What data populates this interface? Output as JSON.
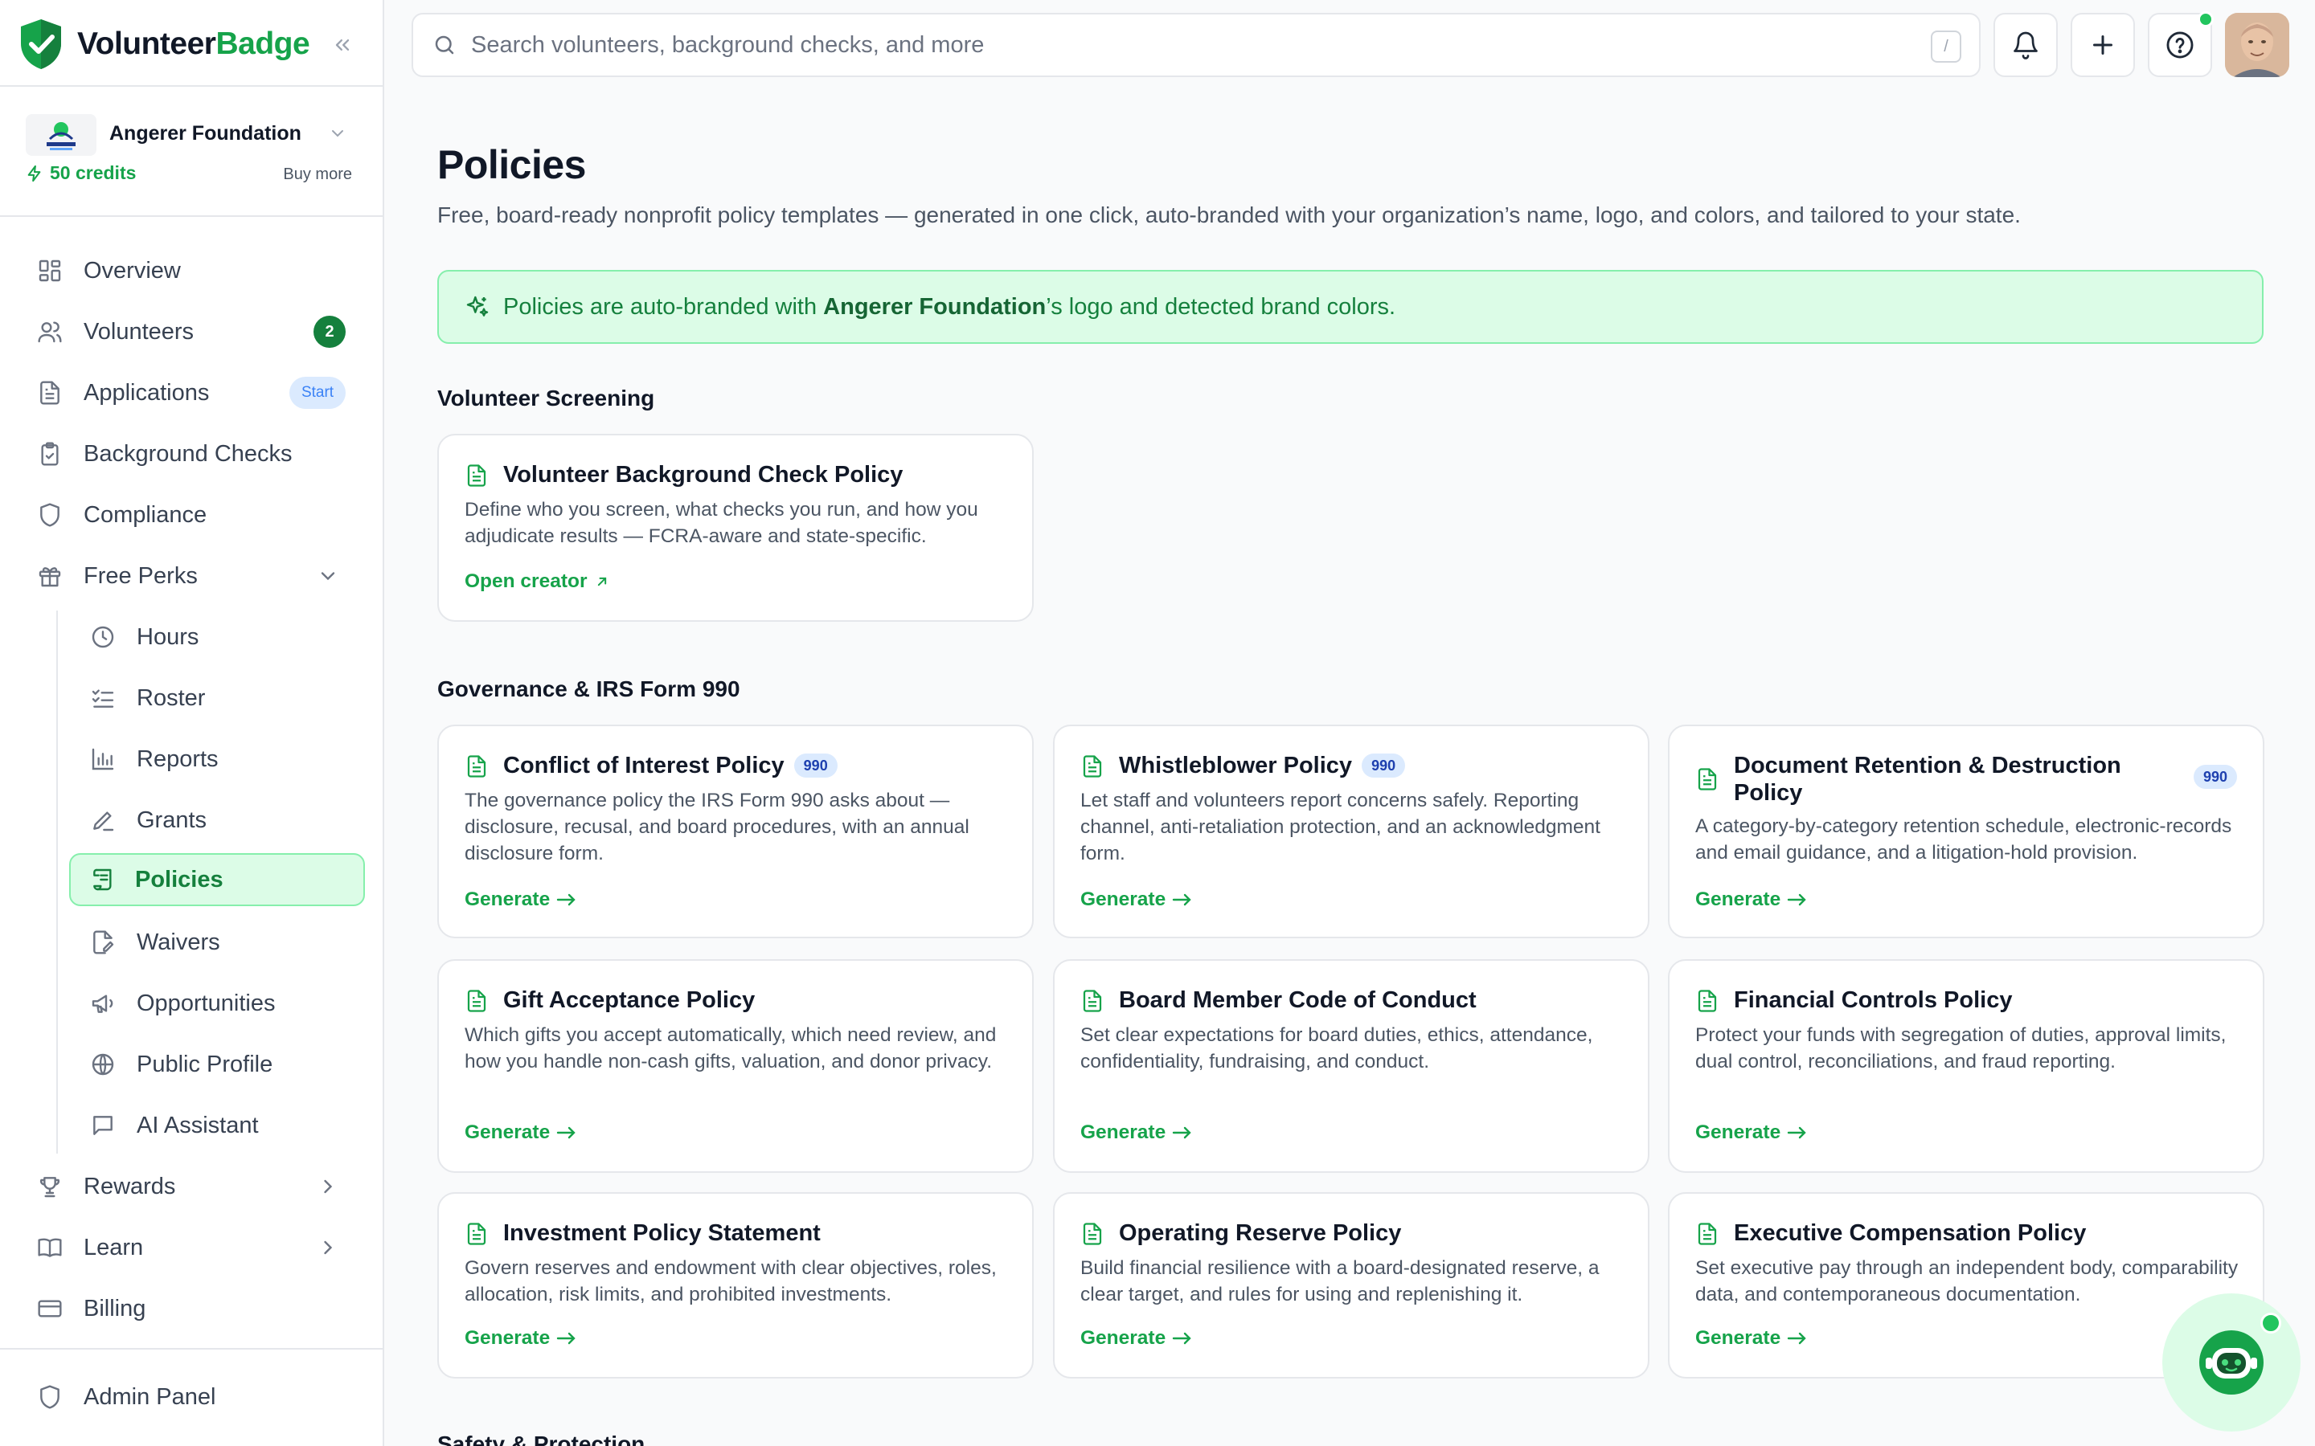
{
  "brand": {
    "name_part1": "Volunteer",
    "name_part2": "Badge"
  },
  "org": {
    "name": "Angerer Foundation",
    "credits": "50 credits",
    "buy_more": "Buy more",
    "logo_text": "ANGERER"
  },
  "nav": {
    "overview": "Overview",
    "volunteers": "Volunteers",
    "volunteers_badge": "2",
    "applications": "Applications",
    "applications_badge": "Start",
    "background_checks": "Background Checks",
    "compliance": "Compliance",
    "free_perks": "Free Perks",
    "hours": "Hours",
    "roster": "Roster",
    "reports": "Reports",
    "grants": "Grants",
    "policies": "Policies",
    "waivers": "Waivers",
    "opportunities": "Opportunities",
    "public_profile": "Public Profile",
    "ai_assistant": "AI Assistant",
    "rewards": "Rewards",
    "learn": "Learn",
    "billing": "Billing",
    "admin_panel": "Admin Panel"
  },
  "search": {
    "placeholder": "Search volunteers, background checks, and more",
    "shortcut": "/"
  },
  "page": {
    "title": "Policies",
    "subtitle": "Free, board-ready nonprofit policy templates — generated in one click, auto-branded with your organization’s name, logo, and colors, and tailored to your state.",
    "banner_prefix": "Policies are auto-branded with ",
    "banner_org": "Angerer Foundation",
    "banner_suffix": "’s logo and detected brand colors."
  },
  "sections": {
    "screening": "Volunteer Screening",
    "governance": "Governance & IRS Form 990",
    "safety": "Safety & Protection"
  },
  "cards": {
    "bg_check": {
      "title": "Volunteer Background Check Policy",
      "desc": "Define who you screen, what checks you run, and how you adjudicate results — FCRA-aware and state-specific.",
      "link": "Open creator"
    },
    "conflict": {
      "title": "Conflict of Interest Policy",
      "pill": "990",
      "desc": "The governance policy the IRS Form 990 asks about — disclosure, recusal, and board procedures, with an annual disclosure form.",
      "link": "Generate"
    },
    "whistleblower": {
      "title": "Whistleblower Policy",
      "pill": "990",
      "desc": "Let staff and volunteers report concerns safely. Reporting channel, anti-retaliation protection, and an acknowledgment form.",
      "link": "Generate"
    },
    "retention": {
      "title": "Document Retention & Destruction Policy",
      "pill": "990",
      "desc": "A category-by-category retention schedule, electronic-records and email guidance, and a litigation-hold provision.",
      "link": "Generate"
    },
    "gift": {
      "title": "Gift Acceptance Policy",
      "desc": "Which gifts you accept automatically, which need review, and how you handle non-cash gifts, valuation, and donor privacy.",
      "link": "Generate"
    },
    "board": {
      "title": "Board Member Code of Conduct",
      "desc": "Set clear expectations for board duties, ethics, attendance, confidentiality, fundraising, and conduct.",
      "link": "Generate"
    },
    "financial": {
      "title": "Financial Controls Policy",
      "desc": "Protect your funds with segregation of duties, approval limits, dual control, reconciliations, and fraud reporting.",
      "link": "Generate"
    },
    "investment": {
      "title": "Investment Policy Statement",
      "desc": "Govern reserves and endowment with clear objectives, roles, allocation, risk limits, and prohibited investments.",
      "link": "Generate"
    },
    "reserve": {
      "title": "Operating Reserve Policy",
      "desc": "Build financial resilience with a board-designated reserve, a clear target, and rules for using and replenishing it.",
      "link": "Generate"
    },
    "exec_comp": {
      "title": "Executive Compensation Policy",
      "desc": "Set executive pay through an independent body, comparability data, and contemporaneous documentation.",
      "link": "Generate"
    }
  },
  "colors": {
    "brand_green": "#16a34a",
    "active_bg": "#dcfce7",
    "pill_bg": "#dbeafe"
  }
}
